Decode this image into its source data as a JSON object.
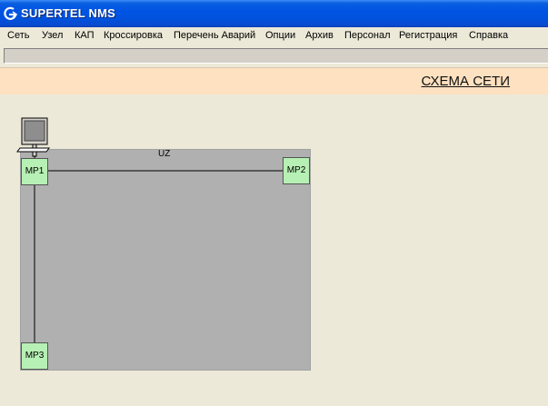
{
  "window": {
    "title": "SUPERTEL NMS",
    "icon": "app-logo-icon"
  },
  "menu": {
    "items": [
      "Сеть",
      "Узел",
      "КАП",
      "Кроссировка",
      "Перечень Аварий",
      "Опции",
      "Архив",
      "Персонал",
      "Регистрация",
      "Справка"
    ]
  },
  "header": {
    "title": "СХЕМА СЕТИ"
  },
  "diagram": {
    "zone": {
      "label": "UZ"
    },
    "nodes": [
      {
        "id": "mp1",
        "label": "MP1"
      },
      {
        "id": "mp2",
        "label": "MP2"
      },
      {
        "id": "mp3",
        "label": "MP3"
      }
    ],
    "links": [
      [
        "MP1",
        "MP2"
      ],
      [
        "MP1",
        "MP3"
      ]
    ],
    "terminal_icon": "computer-terminal-icon"
  },
  "colors": {
    "titlebar": "#0054e3",
    "header_band": "#fee1c0",
    "zone_fill": "#b0b0b0",
    "node_fill": "#b7f0b4",
    "background": "#ece9d8"
  }
}
